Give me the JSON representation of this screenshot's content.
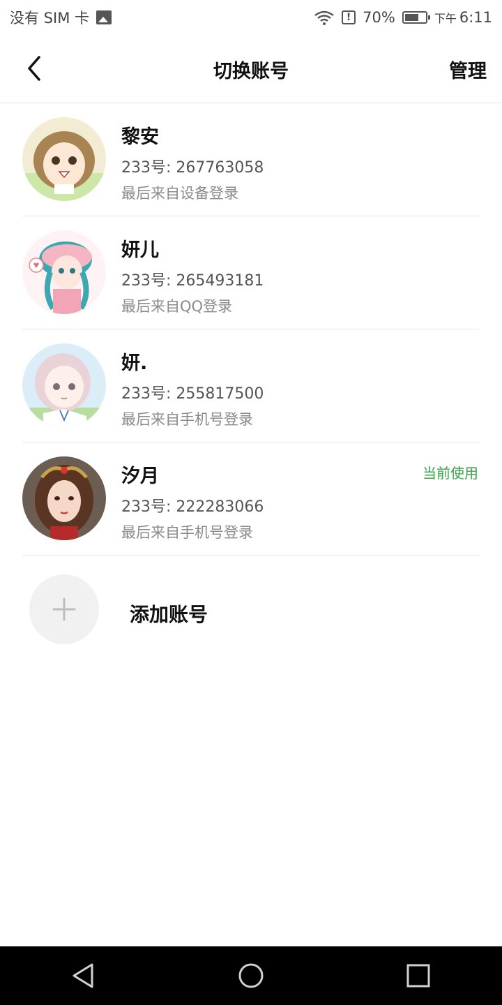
{
  "status_bar": {
    "carrier": "没有 SIM 卡",
    "battery": "70%",
    "time_prefix": "下午",
    "time": "6:11",
    "icons": [
      "image-icon",
      "wifi-icon",
      "alert-icon",
      "battery-icon"
    ]
  },
  "header": {
    "title": "切换账号",
    "manage_label": "管理"
  },
  "accounts": [
    {
      "name": "黎安",
      "id": "233号: 267763058",
      "login": "最后来自设备登录",
      "current": ""
    },
    {
      "name": "妍儿",
      "id": "233号: 265493181",
      "login": "最后来自QQ登录",
      "current": ""
    },
    {
      "name": "妍.",
      "id": "233号: 255817500",
      "login": "最后来自手机号登录",
      "current": ""
    },
    {
      "name": "汐月",
      "id": "233号: 222283066",
      "login": "最后来自手机号登录",
      "current": "当前使用"
    }
  ],
  "add_account": {
    "label": "添加账号"
  },
  "colors": {
    "current_badge": "#3aa34a",
    "nav_bg": "#000000"
  }
}
